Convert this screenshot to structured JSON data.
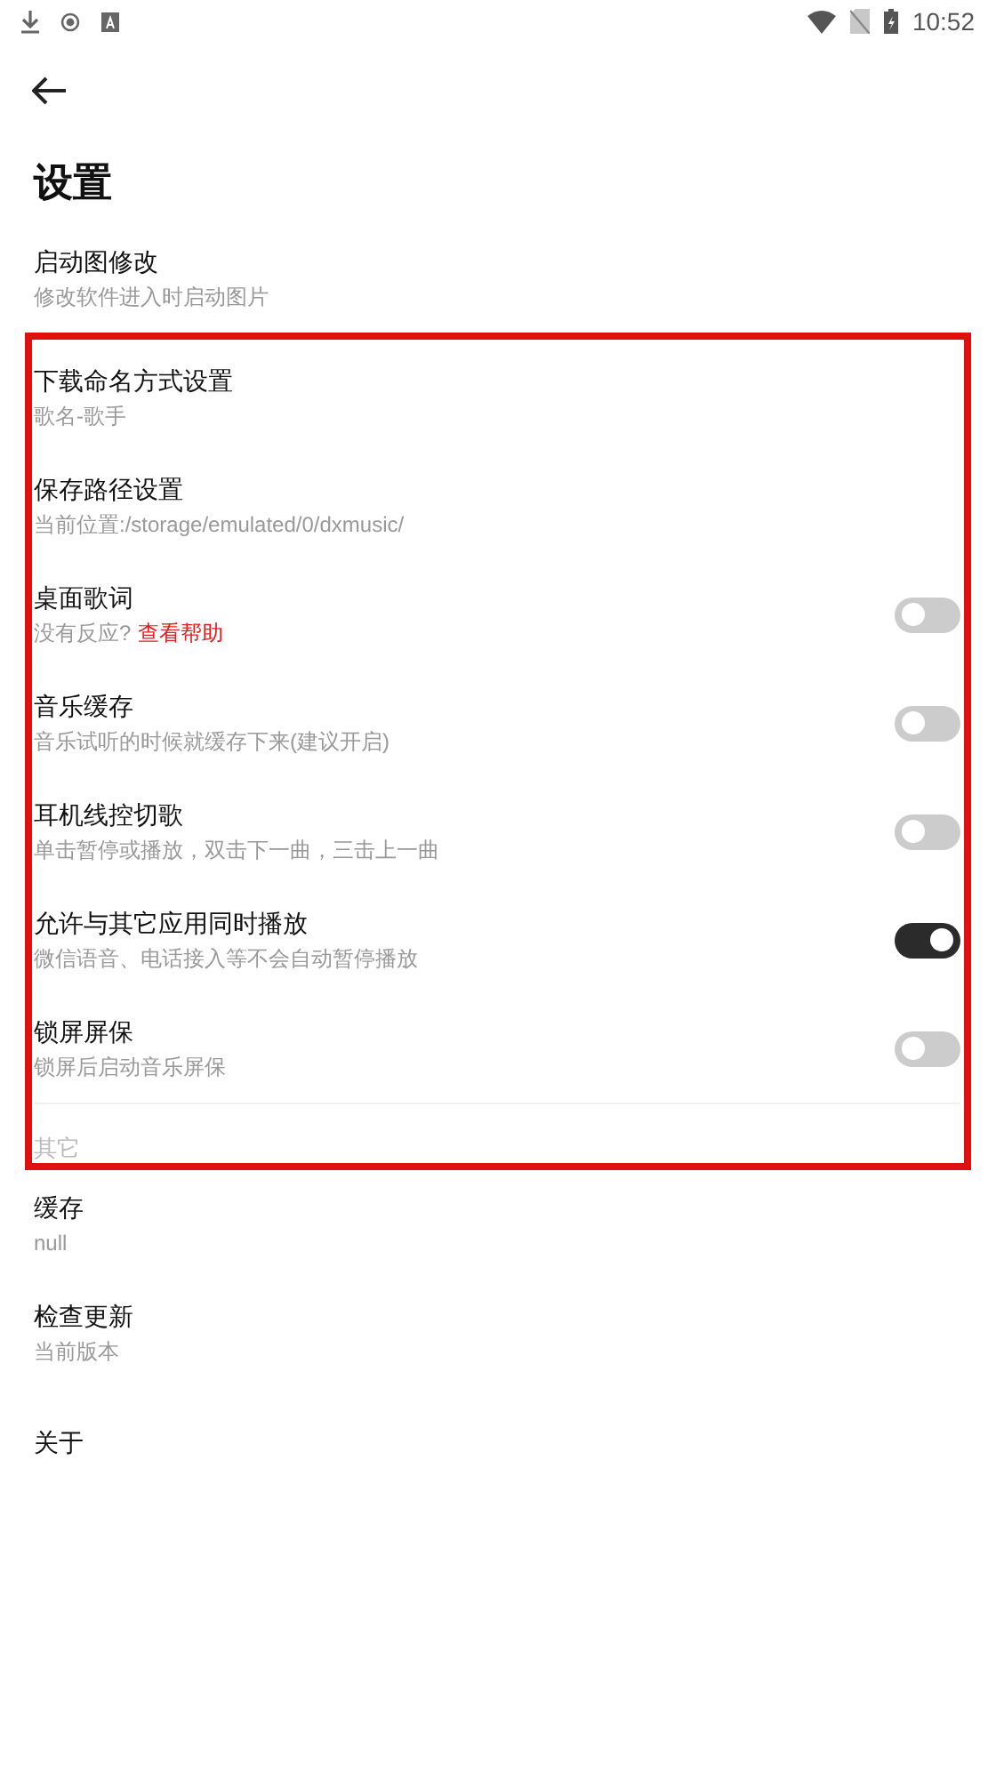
{
  "status_bar": {
    "time": "10:52"
  },
  "title": "设置",
  "sections": [
    {
      "highlighted": false,
      "items": [
        {
          "kind": "plain",
          "title": "启动图修改",
          "subtitle": "修改软件进入时启动图片"
        }
      ]
    },
    {
      "highlighted": true,
      "items": [
        {
          "kind": "plain",
          "title": "下载命名方式设置",
          "subtitle": "歌名-歌手"
        },
        {
          "kind": "plain",
          "title": "保存路径设置",
          "subtitle": "当前位置:/storage/emulated/0/dxmusic/"
        },
        {
          "kind": "toggle",
          "title": "桌面歌词",
          "subtitle": "没有反应?",
          "link": "查看帮助",
          "on": false
        },
        {
          "kind": "toggle",
          "title": "音乐缓存",
          "subtitle": "音乐试听的时候就缓存下来(建议开启)",
          "on": false
        },
        {
          "kind": "toggle",
          "title": "耳机线控切歌",
          "subtitle": "单击暂停或播放，双击下一曲，三击上一曲",
          "on": false
        },
        {
          "kind": "toggle",
          "title": "允许与其它应用同时播放",
          "subtitle": "微信语音、电话接入等不会自动暂停播放",
          "on": true
        },
        {
          "kind": "toggle",
          "title": "锁屏屏保",
          "subtitle": "锁屏后启动音乐屏保",
          "on": false
        },
        {
          "kind": "header",
          "title": "其它"
        }
      ]
    },
    {
      "highlighted": false,
      "items": [
        {
          "kind": "plain",
          "title": "缓存",
          "subtitle": "null"
        },
        {
          "kind": "plain",
          "title": "检查更新",
          "subtitle": "当前版本"
        },
        {
          "kind": "plain",
          "title": "关于"
        }
      ]
    }
  ]
}
